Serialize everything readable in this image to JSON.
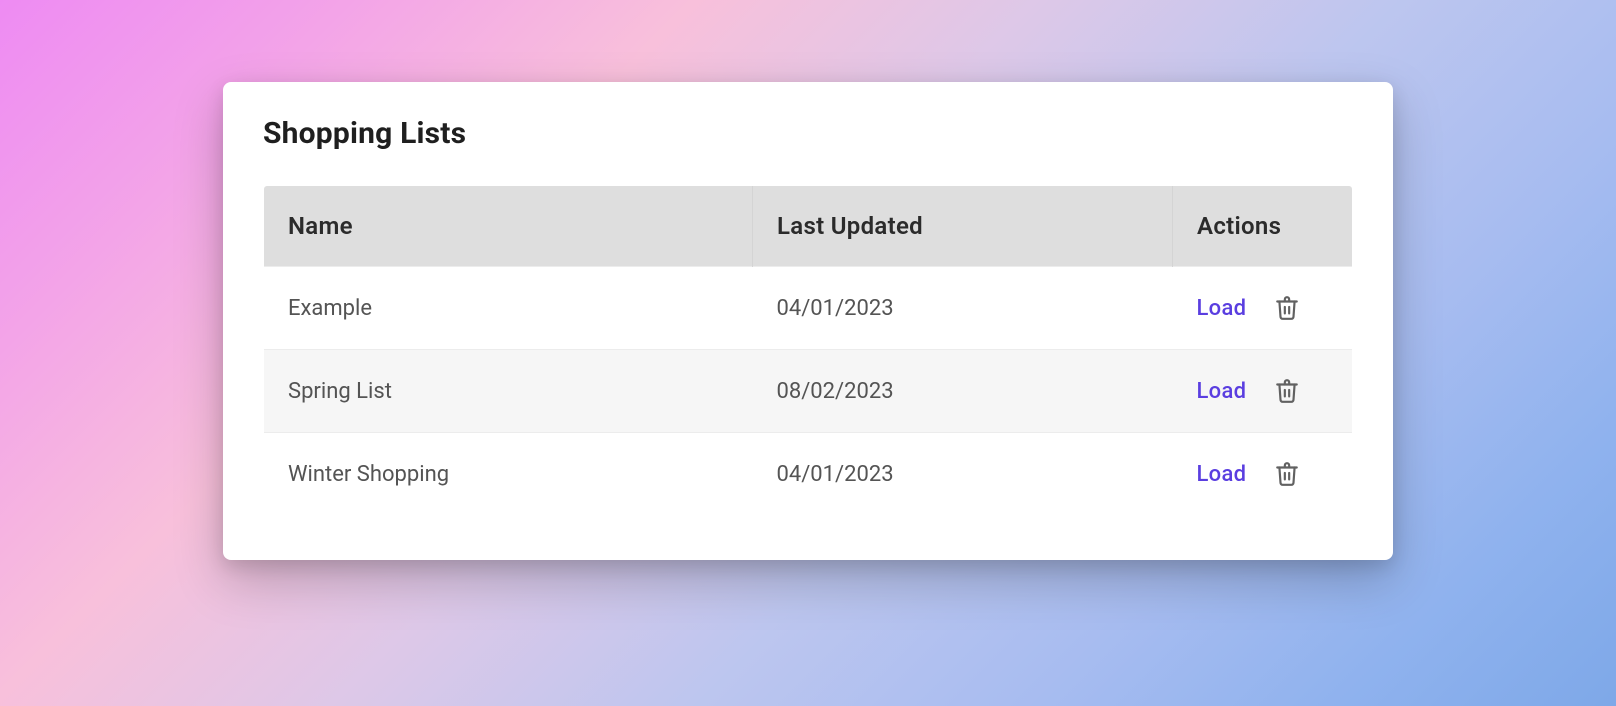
{
  "card": {
    "title": "Shopping Lists"
  },
  "table": {
    "columns": {
      "name": "Name",
      "updated": "Last Updated",
      "actions": "Actions"
    },
    "load_label": "Load",
    "rows": [
      {
        "name": "Example",
        "updated": "04/01/2023"
      },
      {
        "name": "Spring List",
        "updated": "08/02/2023"
      },
      {
        "name": "Winter Shopping",
        "updated": "04/01/2023"
      }
    ]
  },
  "icons": {
    "trash": "trash-icon"
  }
}
